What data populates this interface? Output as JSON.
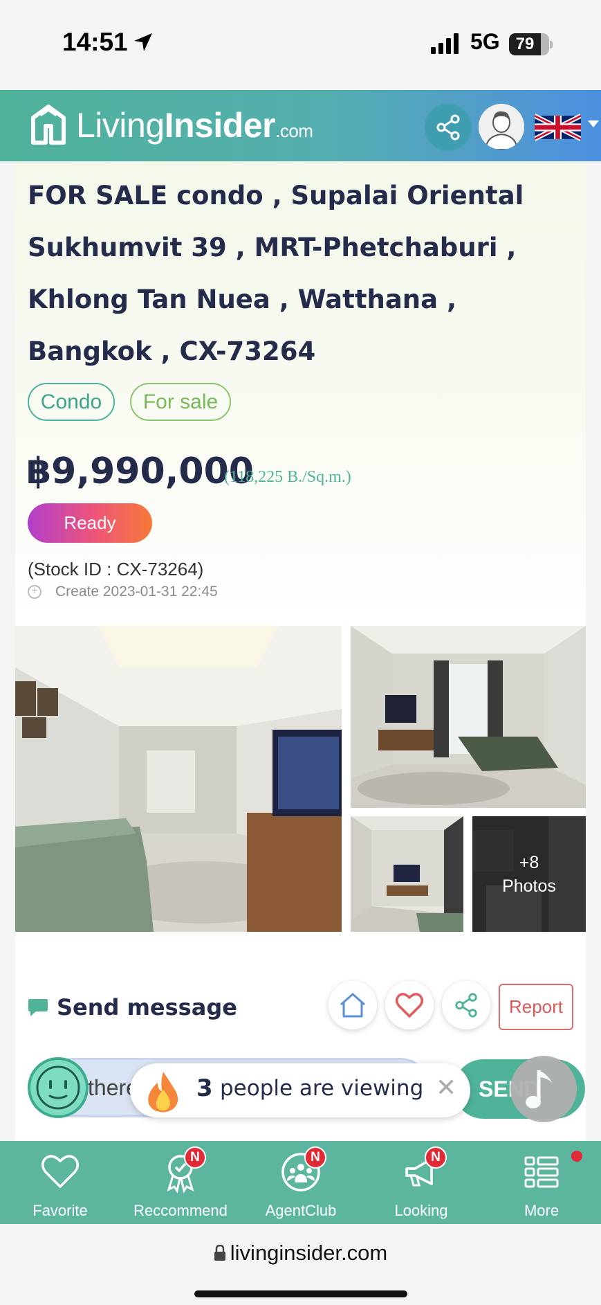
{
  "status_bar": {
    "time": "14:51",
    "network": "5G",
    "battery": "79"
  },
  "header": {
    "logo_part1": "Living",
    "logo_part2": "Insider",
    "logo_suffix": ".com",
    "colors": {
      "brand_green": "#4fb39a",
      "brand_blue": "#4d8fe0"
    }
  },
  "listing": {
    "title": "FOR SALE condo , Supalai Oriental Sukhumvit 39 , MRT-Phetchaburi , Khlong Tan Nuea , Watthana , Bangkok , CX-73264",
    "tags": [
      "Condo",
      "For sale"
    ],
    "price": "฿9,990,000",
    "price_per_sqm": "(118,225 B./Sq.m.)",
    "status": "Ready",
    "stock_id": "(Stock ID : CX-73264)",
    "created": "Create 2023-01-31 22:45"
  },
  "gallery": {
    "more_count": "+8",
    "more_label": "Photos"
  },
  "actions": {
    "send_message": "Send message",
    "report": "Report"
  },
  "message_box": {
    "input_text": "there",
    "send_label": "SEND"
  },
  "viewing_popup": {
    "count": "3",
    "text": "people are viewing"
  },
  "bottom_nav": [
    {
      "label": "Favorite",
      "icon": "heart-icon",
      "badge": ""
    },
    {
      "label": "Reccommend",
      "icon": "award-icon",
      "badge": "N"
    },
    {
      "label": "AgentClub",
      "icon": "group-icon",
      "badge": "N"
    },
    {
      "label": "Looking",
      "icon": "megaphone-icon",
      "badge": "N"
    },
    {
      "label": "More",
      "icon": "list-icon",
      "badge": ""
    }
  ],
  "browser": {
    "url": "livinginsider.com"
  }
}
